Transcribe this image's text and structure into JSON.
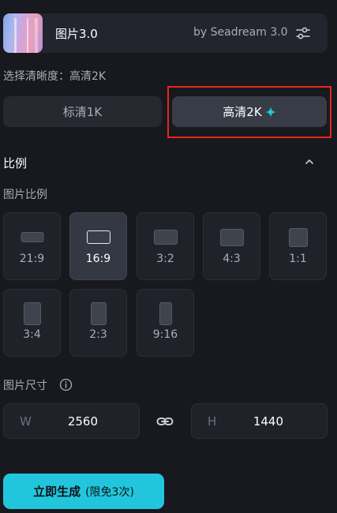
{
  "model": {
    "name": "图片3.0",
    "by": "by Seadream 3.0",
    "settings_icon": "sliders-icon"
  },
  "resolution": {
    "label": "选择清晰度：高清2K",
    "options": [
      {
        "label": "标清1K",
        "selected": false
      },
      {
        "label": "高清2K",
        "selected": true,
        "icon": "sparkle-icon"
      }
    ],
    "accent": "#22c6dc",
    "highlight_color": "#e5281c"
  },
  "ratio": {
    "heading": "比例",
    "collapse_icon": "chevron-up-icon",
    "sublabel": "图片比例",
    "selected": "16:9",
    "options": [
      "21:9",
      "16:9",
      "3:2",
      "4:3",
      "1:1",
      "3:4",
      "2:3",
      "9:16"
    ]
  },
  "size": {
    "label": "图片尺寸",
    "info_icon": "info-icon",
    "width_key": "W",
    "width": "2560",
    "link_icon": "link-icon",
    "height_key": "H",
    "height": "1440"
  },
  "generate": {
    "label": "立即生成",
    "note": "(限免3次)",
    "color": "#22c6dc"
  }
}
